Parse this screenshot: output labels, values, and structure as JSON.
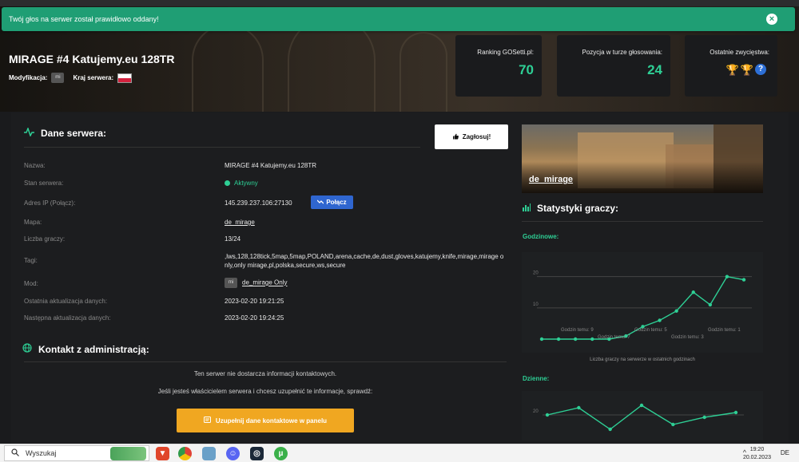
{
  "alert": {
    "text": "Twój głos na serwer został prawidłowo oddany!"
  },
  "header": {
    "server_name": "MIRAGE #4 Katujemy.eu 128TR",
    "mod_label": "Modyfikacja:",
    "mod_badge": "mi",
    "country_label": "Kraj serwera:",
    "country": "Poland"
  },
  "stats": [
    {
      "label": "Ranking GOSetti.pl:",
      "value": "70"
    },
    {
      "label": "Pozycja w turze głosowania:",
      "value": "24"
    },
    {
      "label": "Ostatnie zwycięstwa:",
      "trophies": [
        "gold",
        "silver",
        "unknown"
      ],
      "trophy_unknown_glyph": "?"
    }
  ],
  "server_data": {
    "title": "Dane serwera:",
    "vote_button": "Zagłosuj!",
    "rows": [
      {
        "label": "Nazwa:",
        "value": "MIRAGE #4 Katujemy.eu 128TR"
      },
      {
        "label": "Stan serwera:",
        "value": "Aktywny"
      },
      {
        "label": "Adres IP (Połącz):",
        "value": "145.239.237.106:27130"
      },
      {
        "label": "Mapa:",
        "value": "de_mirage"
      },
      {
        "label": "Liczba graczy:",
        "value": "13/24"
      },
      {
        "label": "Tagi:",
        "value": ",lws,128,128tick,5map,5map,POLAND,arena,cache,de,dust,gloves,katujemy,knife,mirage,mirage only,only mirage,pl,polska,secure,ws,secure"
      },
      {
        "label": "Mod:",
        "value": "de_mirage Only",
        "badge": "mi"
      },
      {
        "label": "Ostatnia aktualizacja danych:",
        "value": "2023-02-20 19:21:25"
      },
      {
        "label": "Następna aktualizacja danych:",
        "value": "2023-02-20 19:24:25"
      }
    ],
    "connect_button": "Połącz"
  },
  "contact": {
    "title": "Kontakt z administracją:",
    "line1": "Ten serwer nie dostarcza informacji kontaktowych.",
    "line2": "Jeśli jesteś właścicielem serwera i chcesz uzupełnić te informacje, sprawdź:",
    "button": "Uzupełnij dane kontaktowe w panelu"
  },
  "map": {
    "name": "de_mirage"
  },
  "player_stats": {
    "title": "Statystyki graczy:",
    "hourly_label": "Godzinowe:",
    "daily_label": "Dzienne:",
    "caption": "Liczba graczy na serwerze w ostatnich godzinach"
  },
  "chart_data": [
    {
      "type": "line",
      "title": "Godzinowe:",
      "ylim": [
        0,
        24
      ],
      "y_ticks": [
        10,
        20
      ],
      "x_tick_labels": [
        "Godzin temu: 9",
        "Godzin temu: 7",
        "Godzin temu: 5",
        "Godzin temu: 3",
        "Godzin temu: 1"
      ],
      "values": [
        0,
        0,
        0,
        0,
        0,
        1,
        4,
        6,
        9,
        15,
        11,
        20,
        19
      ],
      "xlabel": "Liczba graczy na serwerze w ostatnich godzinach",
      "color": "#2ecf95"
    },
    {
      "type": "line",
      "title": "Dzienne:",
      "y_ticks": [
        20
      ],
      "values": [
        20,
        23,
        14,
        24,
        16,
        19,
        21
      ],
      "color": "#2ecf95"
    }
  ],
  "taskbar": {
    "search_placeholder": "Wyszukaj",
    "time": "19:20",
    "date": "20.02.2023",
    "lang": "DE"
  },
  "colors": {
    "accent": "#2ecf95",
    "alert": "#1f9e74",
    "connect": "#2f66d0",
    "contact_btn": "#f0a721"
  }
}
